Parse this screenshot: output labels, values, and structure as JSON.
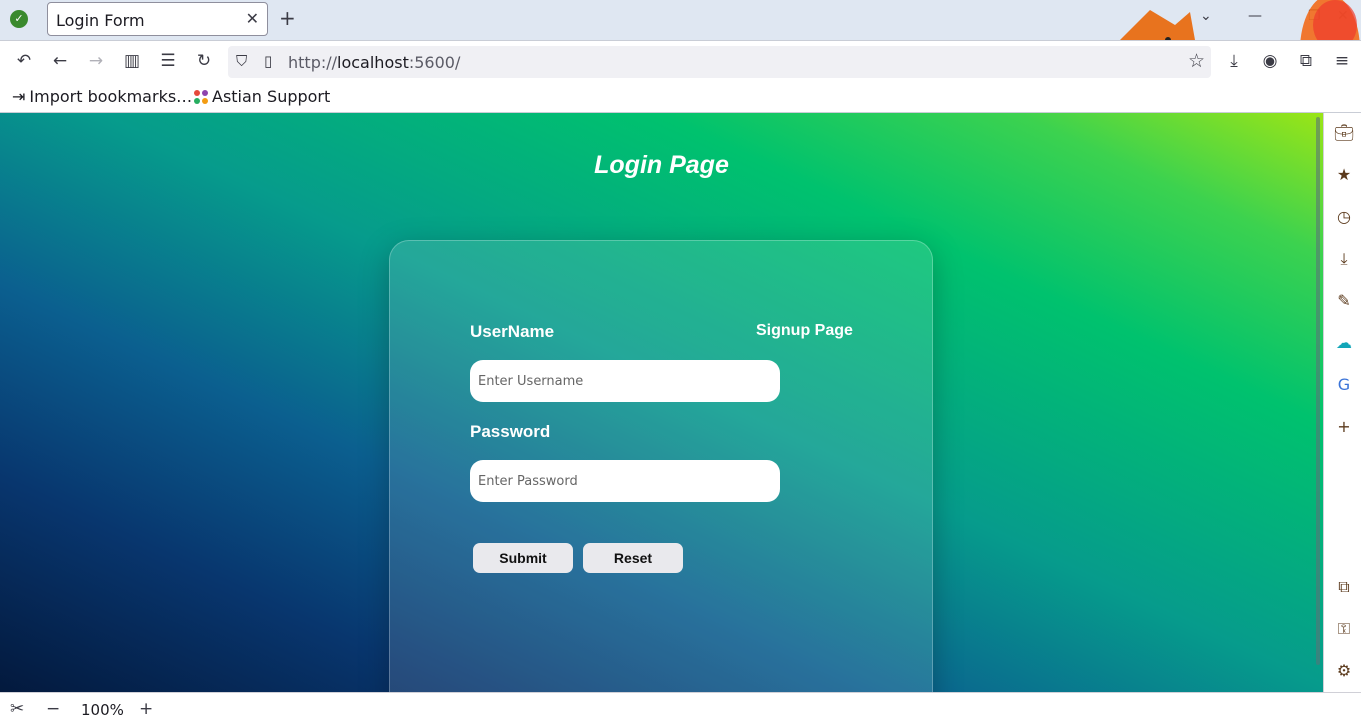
{
  "browser": {
    "tab": {
      "title": "Login Form",
      "close_glyph": "✕"
    },
    "new_tab_glyph": "+",
    "url": {
      "scheme": "http://",
      "host": "localhost",
      "port_path": ":5600/"
    },
    "bookmarks": [
      {
        "label": "Import bookmarks…",
        "icon": "import-icon"
      },
      {
        "label": "Astian Support",
        "icon": "astian-logo-icon"
      }
    ],
    "zoom": {
      "level": "100%"
    }
  },
  "page": {
    "title": "Login Page",
    "form": {
      "username_label": "UserName",
      "username_placeholder": "Enter Username",
      "password_label": "Password",
      "password_placeholder": "Enter Password",
      "submit_label": "Submit",
      "reset_label": "Reset",
      "signup_link": "Signup Page"
    }
  },
  "colors": {
    "gradient_top_right": "#9be516",
    "gradient_mid": "#069b8c",
    "gradient_bottom_left": "#03193d",
    "sidebar_icon": "#5b3a1c"
  }
}
